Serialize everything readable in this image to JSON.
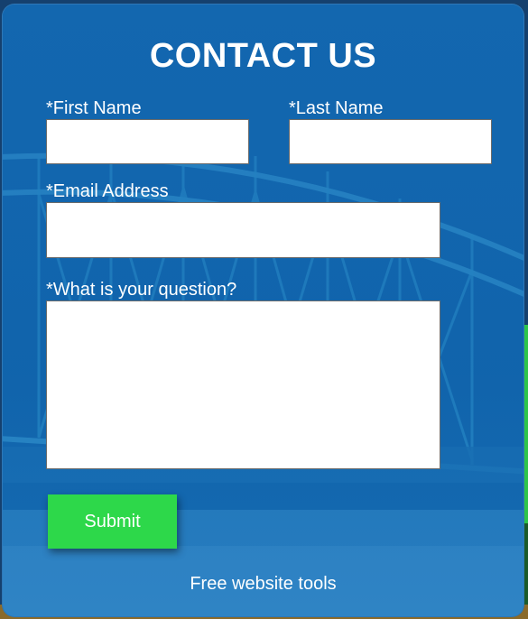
{
  "form": {
    "title": "CONTACT US",
    "first_name_label": "*First Name",
    "first_name_value": "",
    "last_name_label": "*Last Name",
    "last_name_value": "",
    "email_label": "*Email Address",
    "email_value": "",
    "question_label": "*What is your question?",
    "question_value": "",
    "submit_label": "Submit"
  },
  "footer": {
    "link_text": "Free website tools"
  },
  "colors": {
    "panel_blue": "#1266ad",
    "submit_green": "#2dd84a",
    "text_white": "#ffffff"
  }
}
